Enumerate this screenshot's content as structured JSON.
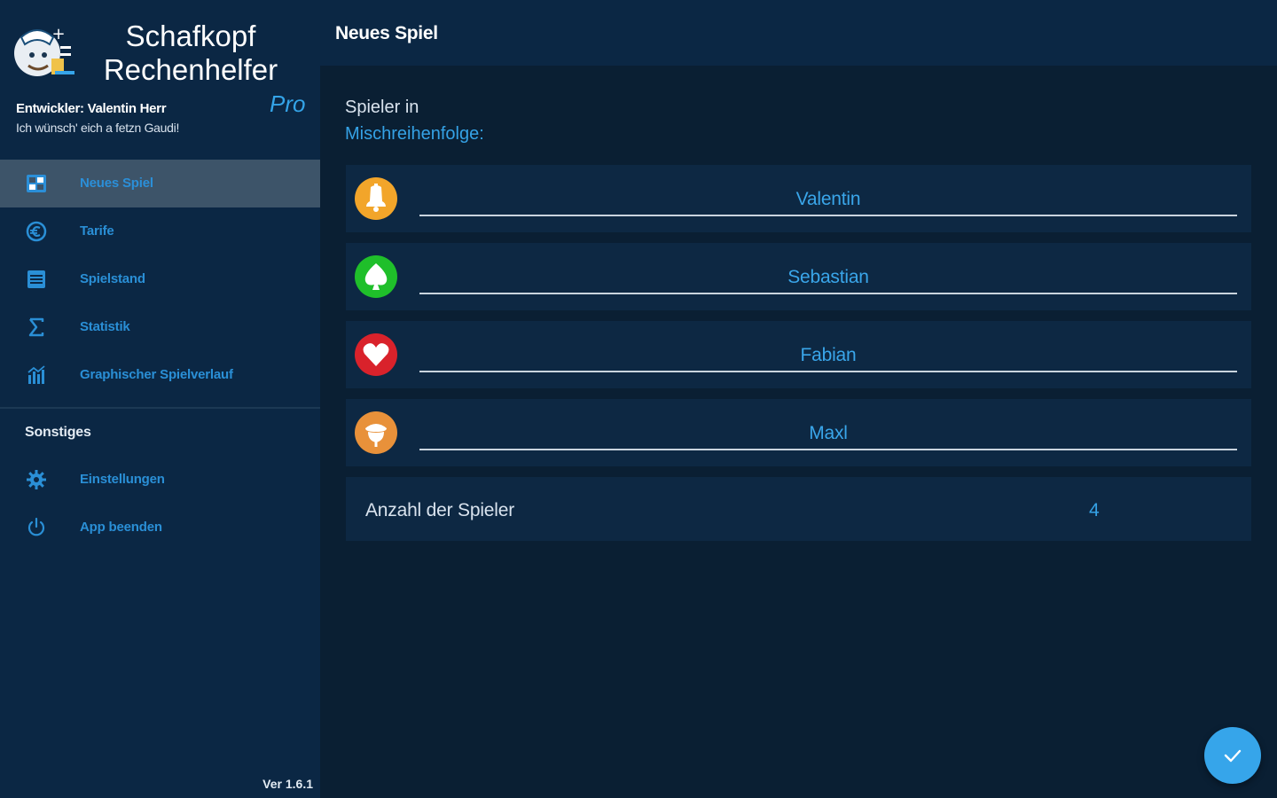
{
  "app": {
    "title": "Schafkopf Rechenhelfer",
    "edition": "Pro",
    "developer": "Entwickler: Valentin Herr",
    "motto": "Ich wünsch' eich a fetzn Gaudi!",
    "version": "Ver 1.6.1"
  },
  "nav": {
    "items": [
      {
        "label": "Neues Spiel",
        "icon": "new-game-icon",
        "active": true
      },
      {
        "label": "Tarife",
        "icon": "euro-icon",
        "active": false
      },
      {
        "label": "Spielstand",
        "icon": "scoreboard-icon",
        "active": false
      },
      {
        "label": "Statistik",
        "icon": "sigma-icon",
        "active": false
      },
      {
        "label": "Graphischer Spielverlauf",
        "icon": "bar-chart-icon",
        "active": false
      }
    ],
    "section_label": "Sonstiges",
    "other_items": [
      {
        "label": "Einstellungen",
        "icon": "gear-icon"
      },
      {
        "label": "App beenden",
        "icon": "power-icon"
      }
    ]
  },
  "header": {
    "title": "Neues Spiel"
  },
  "main": {
    "heading_line1": "Spieler in",
    "heading_line2": "Mischreihenfolge:",
    "players": [
      {
        "name": "Valentin",
        "suit": "bell-icon",
        "color": "#f2a52a"
      },
      {
        "name": "Sebastian",
        "suit": "leaf-icon",
        "color": "#1fbf2a"
      },
      {
        "name": "Fabian",
        "suit": "heart-icon",
        "color": "#d9222b"
      },
      {
        "name": "Maxl",
        "suit": "acorn-icon",
        "color": "#e8913a"
      }
    ],
    "player_count_label": "Anzahl der Spieler",
    "player_count_value": "4"
  },
  "colors": {
    "accent": "#36a5ea",
    "sidebar_bg": "#0b2744",
    "main_bg": "#0a1f33"
  }
}
